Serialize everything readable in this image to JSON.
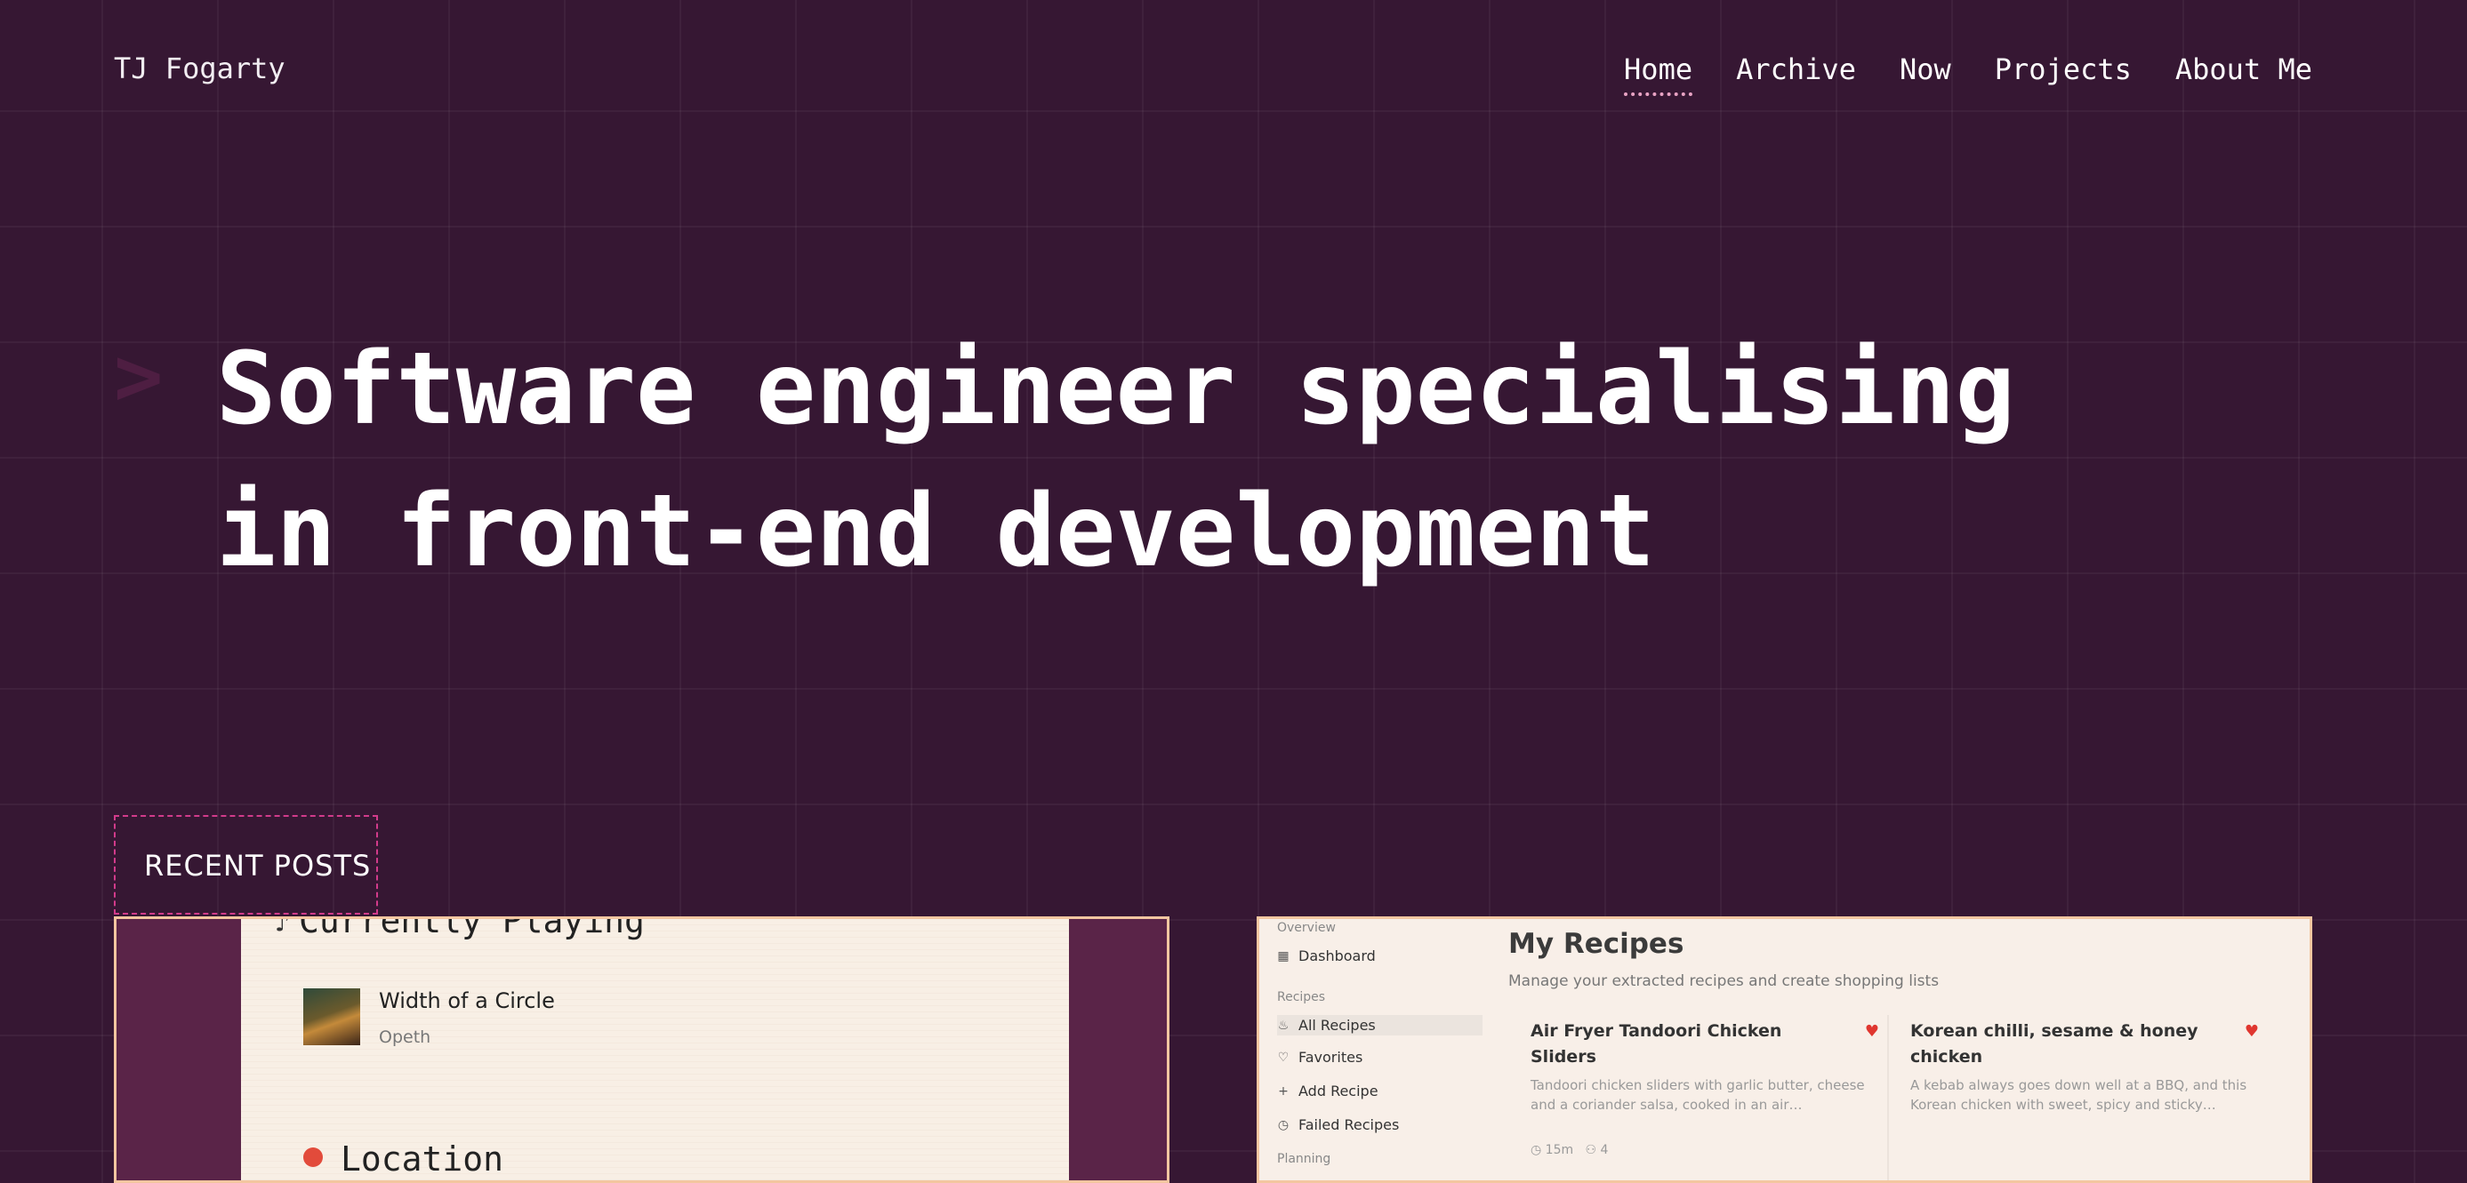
{
  "site": {
    "title": "TJ Fogarty"
  },
  "nav": {
    "items": [
      {
        "label": "Home",
        "active": true
      },
      {
        "label": "Archive"
      },
      {
        "label": "Now"
      },
      {
        "label": "Projects"
      },
      {
        "label": "About Me"
      }
    ]
  },
  "hero": {
    "prompt": ">",
    "line1": "Software engineer specialising",
    "line2": "in front-end development"
  },
  "section": {
    "title": "RECENT POSTS"
  },
  "posts": [
    {
      "heading": "Currently Playing",
      "song": "Width of a Circle",
      "artist": "Opeth",
      "location_heading": "Location"
    },
    {
      "overview": "Overview",
      "dashboard": "Dashboard",
      "recipes_heading": "Recipes",
      "all_recipes": "All Recipes",
      "favorites": "Favorites",
      "add_recipe": "Add Recipe",
      "failed_recipes": "Failed Recipes",
      "planning": "Planning",
      "title": "My Recipes",
      "subtitle": "Manage your extracted recipes and create shopping lists",
      "recipes": [
        {
          "title": "Air Fryer Tandoori Chicken Sliders",
          "desc": "Tandoori chicken sliders with garlic butter, cheese and a coriander salsa, cooked in an air…",
          "time": "15m",
          "servings": "4"
        },
        {
          "title": "Korean chilli, sesame & honey chicken",
          "desc": "A kebab always goes down well at a BBQ, and this Korean chicken with sweet, spicy and sticky…"
        }
      ]
    }
  ],
  "colors": {
    "background": "#361733",
    "accent": "#d23b8b",
    "card_border": "#f3c6a0"
  }
}
